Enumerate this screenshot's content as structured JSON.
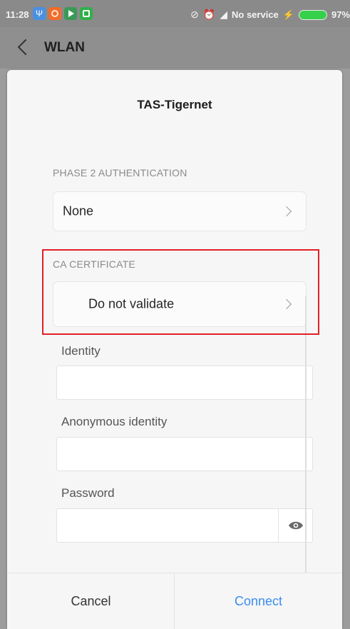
{
  "status_bar": {
    "time": "11:28",
    "network": "No service",
    "battery": "97%",
    "battery_color": "#37d04a"
  },
  "header": {
    "title": "WLAN"
  },
  "dialog": {
    "title": "TAS-Tigernet",
    "phase2": {
      "label": "PHASE 2 AUTHENTICATION",
      "value": "None"
    },
    "ca_certificate": {
      "label": "CA CERTIFICATE",
      "value": "Do not validate"
    },
    "identity": {
      "label": "Identity",
      "value": ""
    },
    "anonymous_identity": {
      "label": "Anonymous identity",
      "value": ""
    },
    "password": {
      "label": "Password",
      "value": ""
    },
    "cancel_label": "Cancel",
    "connect_label": "Connect"
  },
  "colors": {
    "accent": "#3a8df0",
    "highlight": "#e21f26"
  }
}
